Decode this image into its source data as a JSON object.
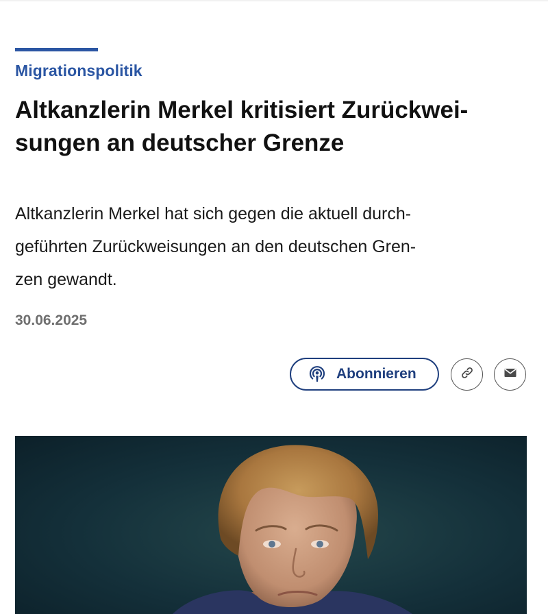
{
  "article": {
    "kicker": "Migrationspolitik",
    "headline_lines": [
      "Altkanzlerin Merkel kritisiert Zurückwei-",
      "sungen an deutscher Grenze"
    ],
    "lead_lines": [
      "Altkanzlerin Merkel hat sich gegen die aktuell durch-",
      "geführten Zurückweisungen an den deutschen Gren-",
      "zen gewandt."
    ],
    "date": "30.06.2025"
  },
  "actions": {
    "subscribe_label": "Abonnieren",
    "subscribe_icon": "podcast-icon",
    "link_icon": "link-icon",
    "mail_icon": "mail-icon"
  },
  "colors": {
    "accent": "#2b56a3",
    "button_border": "#1f3f7e",
    "date_gray": "#6f6f6f",
    "photo_background": "#1a3a40"
  }
}
